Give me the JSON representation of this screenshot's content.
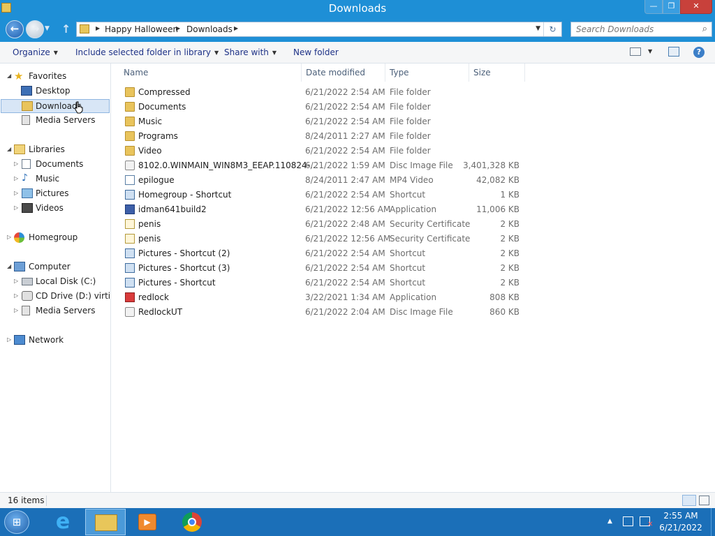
{
  "window": {
    "title": "Downloads"
  },
  "titlebar_buttons": {
    "minimize": "—",
    "maximize": "❐",
    "close": "✕"
  },
  "nav_buttons": {
    "back": "←",
    "forward": "→",
    "dropdown": "▼",
    "up": "↑"
  },
  "address": {
    "breadcrumbs": [
      "Happy Halloween",
      "Downloads"
    ],
    "separator": "▶",
    "dropdown": "▼",
    "refresh": "↻"
  },
  "search": {
    "placeholder": "Search Downloads",
    "icon": "⌕"
  },
  "toolbar": {
    "organize": "Organize",
    "include": "Include selected folder in library",
    "share": "Share with",
    "new_folder": "New folder",
    "caret": "▼",
    "help": "?"
  },
  "nav": {
    "favorites": "Favorites",
    "desktop": "Desktop",
    "downloads": "Downloads",
    "media_servers_fav": "Media Servers",
    "libraries": "Libraries",
    "documents": "Documents",
    "music": "Music",
    "pictures": "Pictures",
    "videos": "Videos",
    "homegroup": "Homegroup",
    "computer": "Computer",
    "local_disk": "Local Disk (C:)",
    "cd_drive": "CD Drive (D:) virtio-w",
    "media_servers_comp": "Media Servers",
    "network": "Network",
    "expanded": "◢",
    "collapsed": "▷"
  },
  "columns": {
    "name": "Name",
    "date": "Date modified",
    "type": "Type",
    "size": "Size",
    "sort": "▲"
  },
  "files": [
    {
      "name": "Compressed",
      "date": "6/21/2022 2:54 AM",
      "type": "File folder",
      "size": "",
      "icon": "folder-icon"
    },
    {
      "name": "Documents",
      "date": "6/21/2022 2:54 AM",
      "type": "File folder",
      "size": "",
      "icon": "folder-icon"
    },
    {
      "name": "Music",
      "date": "6/21/2022 2:54 AM",
      "type": "File folder",
      "size": "",
      "icon": "folder-icon"
    },
    {
      "name": "Programs",
      "date": "8/24/2011 2:27 AM",
      "type": "File folder",
      "size": "",
      "icon": "folder-icon"
    },
    {
      "name": "Video",
      "date": "6/21/2022 2:54 AM",
      "type": "File folder",
      "size": "",
      "icon": "folder-icon"
    },
    {
      "name": "8102.0.WINMAIN_WIN8M3_EEAP.110824-...",
      "date": "6/21/2022 1:59 AM",
      "type": "Disc Image File",
      "size": "3,401,328 KB",
      "icon": "disc-image-icon"
    },
    {
      "name": "epilogue",
      "date": "8/24/2011 2:47 AM",
      "type": "MP4 Video",
      "size": "42,082 KB",
      "icon": "video-file-icon"
    },
    {
      "name": "Homegroup - Shortcut",
      "date": "6/21/2022 2:54 AM",
      "type": "Shortcut",
      "size": "1 KB",
      "icon": "shortcut-icon"
    },
    {
      "name": "idman641build2",
      "date": "6/21/2022 12:56 AM",
      "type": "Application",
      "size": "11,006 KB",
      "icon": "application-icon"
    },
    {
      "name": "penis",
      "date": "6/21/2022 2:48 AM",
      "type": "Security Certificate",
      "size": "2 KB",
      "icon": "certificate-icon"
    },
    {
      "name": "penis",
      "date": "6/21/2022 12:56 AM",
      "type": "Security Certificate",
      "size": "2 KB",
      "icon": "certificate-icon"
    },
    {
      "name": "Pictures - Shortcut (2)",
      "date": "6/21/2022 2:54 AM",
      "type": "Shortcut",
      "size": "2 KB",
      "icon": "shortcut-icon"
    },
    {
      "name": "Pictures - Shortcut (3)",
      "date": "6/21/2022 2:54 AM",
      "type": "Shortcut",
      "size": "2 KB",
      "icon": "shortcut-icon"
    },
    {
      "name": "Pictures - Shortcut",
      "date": "6/21/2022 2:54 AM",
      "type": "Shortcut",
      "size": "2 KB",
      "icon": "shortcut-icon"
    },
    {
      "name": "redlock",
      "date": "3/22/2021 1:34 AM",
      "type": "Application",
      "size": "808 KB",
      "icon": "redlock-app-icon"
    },
    {
      "name": "RedlockUT",
      "date": "6/21/2022 2:04 AM",
      "type": "Disc Image File",
      "size": "860 KB",
      "icon": "disc-image-icon"
    }
  ],
  "status": {
    "count": "16 items"
  },
  "taskbar": {
    "start": "⊞",
    "ie": "e",
    "media": "▶",
    "tray_arrow": "▲",
    "volume_muted": "✕",
    "time": "2:55 AM",
    "date": "6/21/2022"
  }
}
